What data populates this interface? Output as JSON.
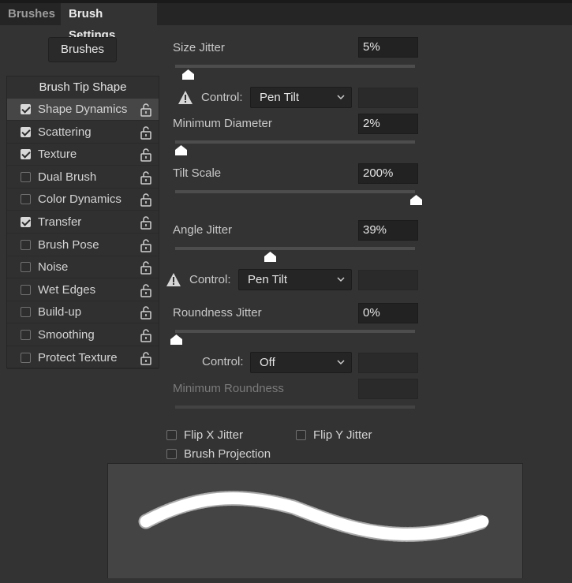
{
  "tabs": [
    {
      "label": "Brushes",
      "active": false
    },
    {
      "label": "Brush Settings",
      "active": true
    }
  ],
  "brushes_button": "Brushes",
  "list": {
    "header": "Brush Tip Shape",
    "items": [
      {
        "label": "Shape Dynamics",
        "checked": true,
        "selected": true
      },
      {
        "label": "Scattering",
        "checked": true
      },
      {
        "label": "Texture",
        "checked": true
      },
      {
        "label": "Dual Brush",
        "checked": false
      },
      {
        "label": "Color Dynamics",
        "checked": false
      },
      {
        "label": "Transfer",
        "checked": true
      },
      {
        "label": "Brush Pose",
        "checked": false
      },
      {
        "label": "Noise",
        "checked": false
      },
      {
        "label": "Wet Edges",
        "checked": false
      },
      {
        "label": "Build-up",
        "checked": false
      },
      {
        "label": "Smoothing",
        "checked": false
      },
      {
        "label": "Protect Texture",
        "checked": false
      }
    ]
  },
  "settings": {
    "size_jitter": {
      "label": "Size Jitter",
      "value": "5%",
      "slider": 0.05
    },
    "control1": {
      "label": "Control:",
      "value": "Pen Tilt"
    },
    "min_diameter": {
      "label": "Minimum Diameter",
      "value": "2%",
      "slider": 0.02
    },
    "tilt_scale": {
      "label": "Tilt Scale",
      "value": "200%",
      "slider": 1.0
    },
    "angle_jitter": {
      "label": "Angle Jitter",
      "value": "39%",
      "slider": 0.39
    },
    "control2": {
      "label": "Control:",
      "value": "Pen Tilt"
    },
    "roundness_jitter": {
      "label": "Roundness Jitter",
      "value": "0%",
      "slider": 0.0
    },
    "control3": {
      "label": "Control:",
      "value": "Off"
    },
    "min_roundness": {
      "label": "Minimum Roundness",
      "value": ""
    }
  },
  "options": {
    "flip_x": {
      "label": "Flip X Jitter",
      "checked": false
    },
    "flip_y": {
      "label": "Flip Y Jitter",
      "checked": false
    },
    "projection": {
      "label": "Brush Projection",
      "checked": false
    }
  },
  "colors": {
    "panel": "#333333",
    "tabbar": "#252525",
    "selected_row": "#464646",
    "preview": "#444444",
    "stroke": "#ffffff"
  }
}
